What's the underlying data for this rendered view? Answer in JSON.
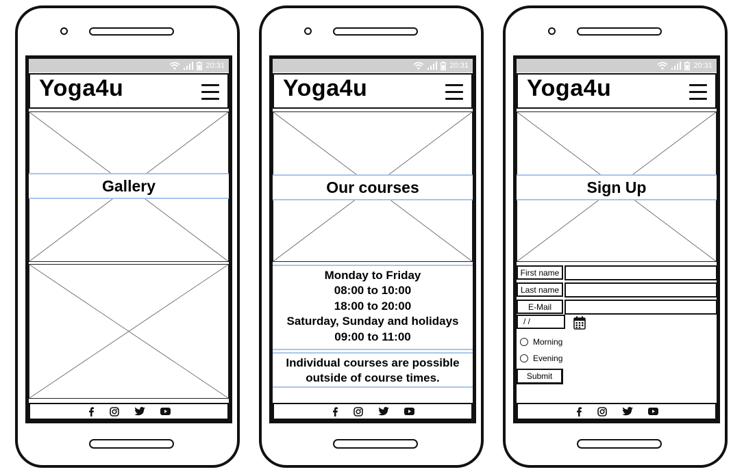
{
  "status_bar": {
    "time": "20:31",
    "icons": [
      "wifi-icon",
      "signal-icon",
      "battery-icon"
    ]
  },
  "brand": "Yoga4u",
  "footer_icons": [
    "facebook-icon",
    "instagram-icon",
    "twitter-icon",
    "youtube-icon"
  ],
  "gallery_screen": {
    "banner": "Gallery"
  },
  "courses_screen": {
    "banner": "Our courses",
    "schedule": [
      "Monday to Friday",
      "08:00 to 10:00",
      "18:00 to 20:00",
      "Saturday, Sunday and holidays",
      "09:00 to 11:00"
    ],
    "note_lines": [
      "Individual courses are possible",
      "outside of course times."
    ]
  },
  "signup_screen": {
    "banner": "Sign Up",
    "first_name_label": "First name",
    "last_name_label": "Last name",
    "email_label": "E-Mail",
    "date_value": "/ /",
    "radio_morning": "Morning",
    "radio_evening": "Evening",
    "submit_label": "Submit"
  },
  "colors": {
    "highlight_border": "#a9c4ec",
    "status_bar": "#cfcfcf",
    "outline": "#111111"
  }
}
